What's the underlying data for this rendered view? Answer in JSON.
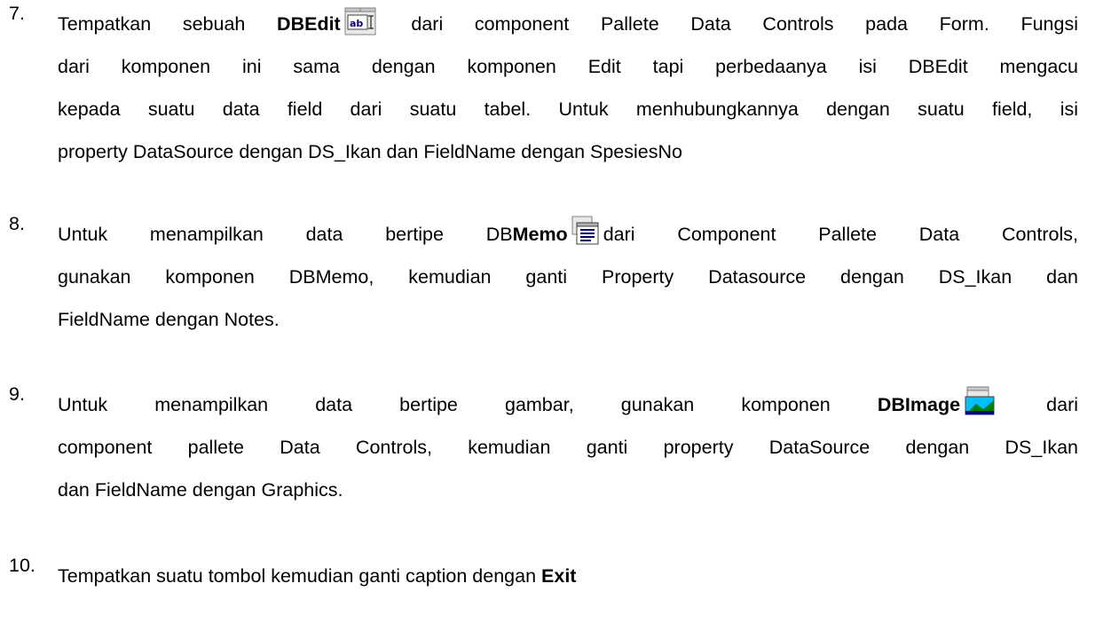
{
  "document": {
    "steps": [
      {
        "number": "7.",
        "lines": [
          {
            "before": "Tempatkan sebuah ",
            "bold": "DBEdit",
            "after": " dari component Pallete Data Controls pada Form. Fungsi"
          },
          {
            "text": "dari komponen ini sama dengan komponen Edit tapi perbedaanya isi DBEdit mengacu"
          },
          {
            "text": "kepada suatu data field dari suatu tabel. Untuk menhubungkannya dengan suatu field, isi"
          },
          {
            "text": "property DataSource dengan DS_Ikan dan FieldName dengan SpesiesNo"
          }
        ],
        "icon": "dbedit-icon",
        "icon_text": "ab"
      },
      {
        "number": "8.",
        "lines": [
          {
            "before": "Untuk menampilkan data bertipe DB",
            "bold": "Memo",
            "after": "dari Component Pallete Data Controls,"
          },
          {
            "text": "gunakan komponen DBMemo, kemudian ganti Property Datasource dengan DS_Ikan dan"
          },
          {
            "text": "FieldName dengan Notes."
          }
        ],
        "icon": "dbmemo-icon"
      },
      {
        "number": "9.",
        "lines": [
          {
            "before": "Untuk menampilkan data bertipe gambar, gunakan komponen ",
            "bold": "DBImage",
            "after": " dari"
          },
          {
            "text": "component pallete Data Controls, kemudian ganti property DataSource dengan DS_Ikan"
          },
          {
            "text": "dan FieldName dengan Graphics."
          }
        ],
        "icon": "dbimage-icon"
      },
      {
        "number": "10.",
        "lines": [
          {
            "before": "Tempatkan suatu tombol kemudian ganti caption dengan ",
            "bold": "Exit",
            "after": ""
          }
        ]
      }
    ]
  }
}
